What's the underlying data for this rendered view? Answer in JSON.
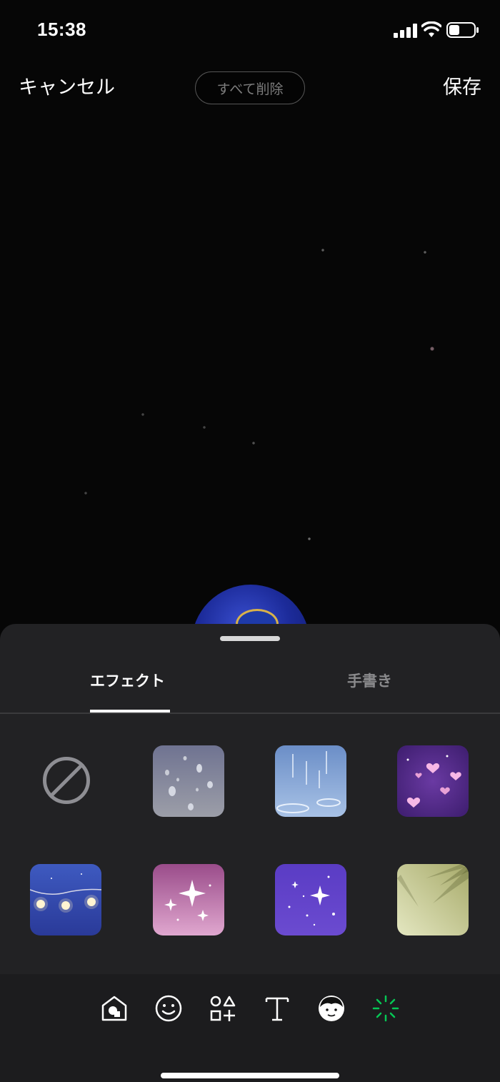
{
  "status_bar": {
    "time": "15:38"
  },
  "topbar": {
    "cancel_label": "キャンセル",
    "delete_all_label": "すべて削除",
    "save_label": "保存"
  },
  "tabs": [
    {
      "label": "エフェクト",
      "active": true
    },
    {
      "label": "手書き",
      "active": false
    }
  ],
  "effects": [
    {
      "name": "none",
      "icon": "no-effect-icon"
    },
    {
      "name": "raindrops"
    },
    {
      "name": "rain"
    },
    {
      "name": "hearts"
    },
    {
      "name": "string-lights"
    },
    {
      "name": "sparkles-pink"
    },
    {
      "name": "stars-purple"
    },
    {
      "name": "palm-shadow"
    }
  ],
  "toolbar": [
    {
      "icon": "sticker-icon"
    },
    {
      "icon": "emoji-icon"
    },
    {
      "icon": "shapes-icon"
    },
    {
      "icon": "text-icon"
    },
    {
      "icon": "avatar-icon"
    },
    {
      "icon": "effect-sparkle-icon",
      "active": true,
      "color": "#06c755"
    }
  ],
  "colors": {
    "accent": "#06c755",
    "sheet_bg": "#222224",
    "inactive_tab": "#8a8a8c"
  }
}
